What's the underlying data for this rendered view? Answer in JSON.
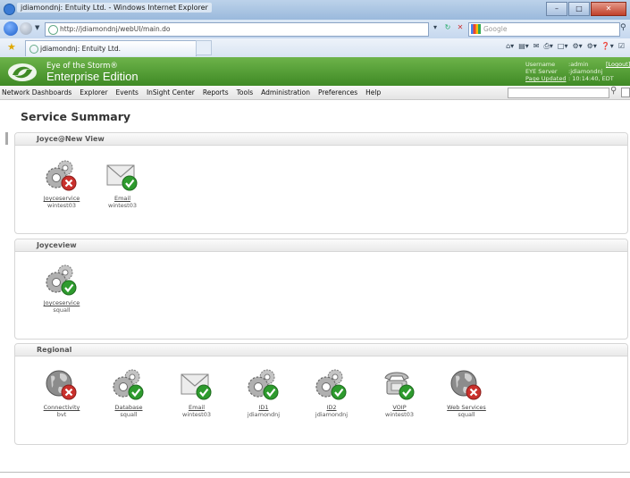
{
  "window": {
    "title": "jdiamondnj: Entuity Ltd. - Windows Internet Explorer",
    "controls": [
      "minimize-icon",
      "maximize-icon",
      "close-icon"
    ]
  },
  "browser": {
    "url": "http://jdiamondnj/webUI/main.do",
    "search_placeholder": "Google",
    "tab_title": "jdiamondnj: Entuity Ltd."
  },
  "app": {
    "name_line1": "Eye of the Storm®",
    "name_line2": "Enterprise Edition",
    "username_label": "Username",
    "username_value": ":admin",
    "server_label": "EYE Server",
    "server_value": ":jdiamondnj",
    "updated_label": "Page Updated",
    "updated_value": ": 10:14:40, EDT",
    "logout": "[Logout]",
    "brand_color": "#4f9b33"
  },
  "menu": {
    "items": [
      "Network Dashboards",
      "Explorer",
      "Events",
      "InSight Center",
      "Reports",
      "Tools",
      "Administration",
      "Preferences",
      "Help"
    ]
  },
  "page": {
    "title": "Service Summary"
  },
  "sections": [
    {
      "title": "Joyce@New View",
      "items": [
        {
          "icon": "service-gears",
          "status": "down",
          "name": "Joyceservice",
          "host": "wintest03"
        },
        {
          "icon": "email-envelope",
          "status": "up",
          "name": "Email",
          "host": "wintest03"
        }
      ]
    },
    {
      "title": "Joyceview",
      "items": [
        {
          "icon": "service-gears",
          "status": "up",
          "name": "Joyceservice",
          "host": "squall"
        }
      ]
    },
    {
      "title": "Regional",
      "items": [
        {
          "icon": "globe",
          "status": "down",
          "name": "Connectivity",
          "host": "bvt"
        },
        {
          "icon": "service-gears",
          "status": "up",
          "name": "Database",
          "host": "squall"
        },
        {
          "icon": "email-envelope",
          "status": "up",
          "name": "Email",
          "host": "wintest03"
        },
        {
          "icon": "service-gears",
          "status": "up",
          "name": "ID1",
          "host": "jdiamondnj"
        },
        {
          "icon": "service-gears",
          "status": "up",
          "name": "ID2",
          "host": "jdiamondnj"
        },
        {
          "icon": "telephone",
          "status": "up",
          "name": "VOIP",
          "host": "wintest03"
        },
        {
          "icon": "globe",
          "status": "down",
          "name": "Web Services",
          "host": "squall"
        }
      ]
    }
  ],
  "status_colors": {
    "up": "#2e9b2e",
    "down": "#c9302c"
  }
}
